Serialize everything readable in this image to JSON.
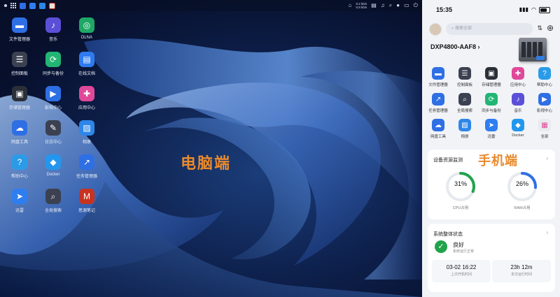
{
  "desktop": {
    "title": "电脑端",
    "topbar": {
      "speed_up": "0.2 kb/s",
      "speed_down": "0.8 kb/s"
    },
    "icons": [
      {
        "label": "文件管理器",
        "icon": "folder-icon",
        "color": "#2f6fe4"
      },
      {
        "label": "音乐",
        "icon": "music-icon",
        "color": "#5b4fd8"
      },
      {
        "label": "DLNA",
        "icon": "dlna-icon",
        "color": "#1fa765"
      },
      {
        "label": "控制面板",
        "icon": "sliders-icon",
        "color": "#3b4150"
      },
      {
        "label": "同步与备份",
        "icon": "sync-icon",
        "color": "#22b573"
      },
      {
        "label": "在线文档",
        "icon": "document-icon",
        "color": "#2e7bf0"
      },
      {
        "label": "存储管理器",
        "icon": "storage-icon",
        "color": "#2b2f38"
      },
      {
        "label": "影视中心",
        "icon": "video-icon",
        "color": "#2f6fe4"
      },
      {
        "label": "应用中心",
        "icon": "app-center-icon",
        "color": "#e0489a"
      },
      {
        "label": "网盘工具",
        "icon": "cloud-drive-icon",
        "color": "#2f6fe4"
      },
      {
        "label": "日志中心",
        "icon": "log-icon",
        "color": "#3b4150"
      },
      {
        "label": "相册",
        "icon": "photo-icon",
        "color": "#2e86e8"
      },
      {
        "label": "帮助中心",
        "icon": "help-icon",
        "color": "#2b9be8"
      },
      {
        "label": "Docker",
        "icon": "docker-icon",
        "color": "#2496ed"
      },
      {
        "label": "任务管理器",
        "icon": "task-manager-icon",
        "color": "#2f6fe4"
      },
      {
        "label": "迅雷",
        "icon": "thunder-icon",
        "color": "#2f7ef0"
      },
      {
        "label": "全局搜索",
        "icon": "global-search-icon",
        "color": "#3b4150"
      },
      {
        "label": "思源笔记",
        "icon": "siyuan-note-icon",
        "color": "#c8331f"
      }
    ]
  },
  "phone": {
    "title": "手机端",
    "status_time": "15:35",
    "search_placeholder": "搜索全部",
    "device_name": "DXP4800-AAF8",
    "apps": [
      {
        "label": "文件管理器",
        "icon": "folder-icon",
        "color": "#2f6fe4"
      },
      {
        "label": "控制面板",
        "icon": "sliders-icon",
        "color": "#3b4150"
      },
      {
        "label": "存储管理器",
        "icon": "storage-icon",
        "color": "#2b2f38"
      },
      {
        "label": "应用中心",
        "icon": "app-center-icon",
        "color": "#e0489a"
      },
      {
        "label": "帮助中心",
        "icon": "help-icon",
        "color": "#2b9be8"
      },
      {
        "label": "任务管理器",
        "icon": "task-manager-icon",
        "color": "#2f6fe4"
      },
      {
        "label": "全局搜索",
        "icon": "global-search-icon",
        "color": "#3b4150"
      },
      {
        "label": "同步与备份",
        "icon": "sync-icon",
        "color": "#22b573"
      },
      {
        "label": "音乐",
        "icon": "music-icon",
        "color": "#5b4fd8"
      },
      {
        "label": "影视中心",
        "icon": "video-icon",
        "color": "#2f6fe4"
      },
      {
        "label": "网盘工具",
        "icon": "cloud-drive-icon",
        "color": "#2f6fe4"
      },
      {
        "label": "相册",
        "icon": "photo-icon",
        "color": "#2e86e8"
      },
      {
        "label": "迅雷",
        "icon": "thunder-icon",
        "color": "#2f7ef0"
      },
      {
        "label": "Docker",
        "icon": "docker-icon",
        "color": "#2496ed"
      },
      {
        "label": "全部",
        "icon": "all-apps-icon",
        "color": "#e8eaee"
      }
    ],
    "monitor": {
      "title": "设备资源监测",
      "cpu_label": "CPU占用",
      "cpu_pct": "31%",
      "cpu_value": 31,
      "ram_label": "RAM占用",
      "ram_pct": "26%",
      "ram_value": 26,
      "cpu_color": "#22a34b",
      "ram_color": "#2f6fe4"
    },
    "status_card": {
      "title": "系统整体状态",
      "state": "良好",
      "state_sub": "系统运行正常",
      "last_boot_value": "03-02 16:22",
      "last_boot_label": "上次开机时间",
      "uptime_value": "23h 12m",
      "uptime_label": "本次运行时间"
    }
  }
}
